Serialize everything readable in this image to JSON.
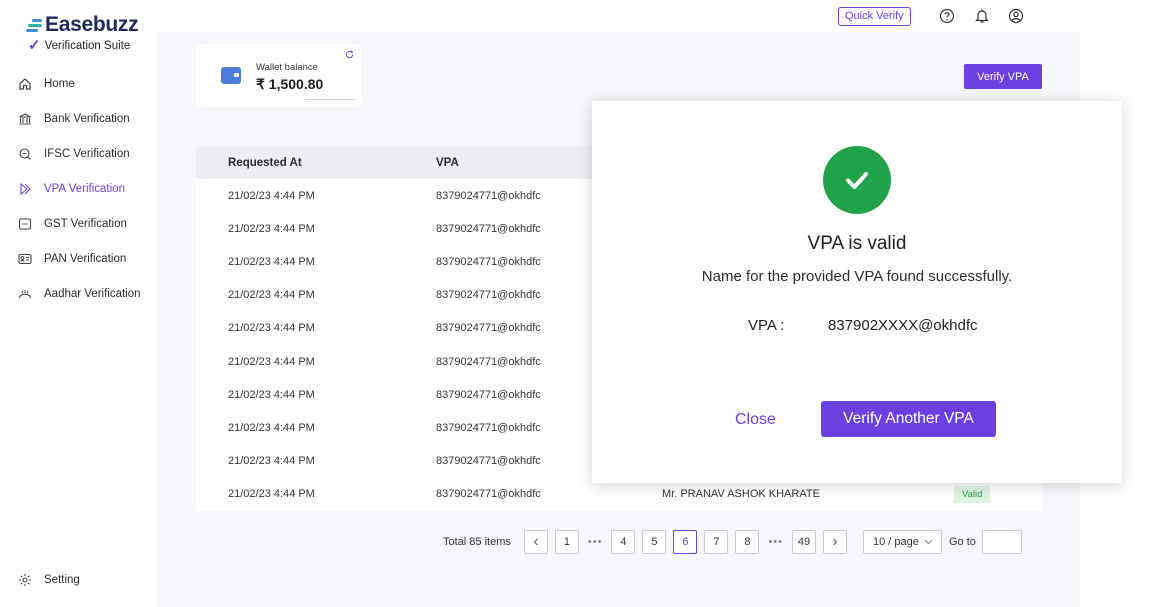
{
  "brand": {
    "name": "Easebuzz",
    "suite": "Verification Suite"
  },
  "sidebar": {
    "items": [
      {
        "label": "Home",
        "icon": "home-icon"
      },
      {
        "label": "Bank Verification",
        "icon": "bank-icon"
      },
      {
        "label": "IFSC Verification",
        "icon": "search-doc-icon"
      },
      {
        "label": "VPA Verification",
        "icon": "vpa-icon",
        "active": true
      },
      {
        "label": "GST Verification",
        "icon": "gst-icon"
      },
      {
        "label": "PAN Verification",
        "icon": "id-card-icon"
      },
      {
        "label": "Aadhar Verification",
        "icon": "aadhar-icon"
      }
    ],
    "setting_label": "Setting"
  },
  "topbar": {
    "quick_verify": "Quick Verify"
  },
  "wallet": {
    "label": "Wallet balance",
    "amount": "₹ 1,500.80"
  },
  "verify_vpa_button": "Verify VPA",
  "table": {
    "columns": [
      "Requested At",
      "VPA"
    ],
    "rows": [
      {
        "requested_at": "21/02/23 4:44 PM",
        "vpa": "8379024771@okhdfc"
      },
      {
        "requested_at": "21/02/23 4:44 PM",
        "vpa": "8379024771@okhdfc"
      },
      {
        "requested_at": "21/02/23 4:44 PM",
        "vpa": "8379024771@okhdfc"
      },
      {
        "requested_at": "21/02/23 4:44 PM",
        "vpa": "8379024771@okhdfc"
      },
      {
        "requested_at": "21/02/23 4:44 PM",
        "vpa": "8379024771@okhdfc"
      },
      {
        "requested_at": "21/02/23 4:44 PM",
        "vpa": "8379024771@okhdfc"
      },
      {
        "requested_at": "21/02/23 4:44 PM",
        "vpa": "8379024771@okhdfc"
      },
      {
        "requested_at": "21/02/23 4:44 PM",
        "vpa": "8379024771@okhdfc"
      },
      {
        "requested_at": "21/02/23 4:44 PM",
        "vpa": "8379024771@okhdfc"
      },
      {
        "requested_at": "21/02/23 4:44 PM",
        "vpa": "8379024771@okhdfc",
        "name": "Mr. PRANAV ASHOK KHARATE",
        "status": "Valid"
      }
    ]
  },
  "pagination": {
    "total": "Total 85 items",
    "prev": "<",
    "next": ">",
    "pages": [
      "1",
      "4",
      "5",
      "6",
      "7",
      "8",
      "49"
    ],
    "current": "6",
    "ellipsis": "•••",
    "per_page": "10 / page",
    "goto_label": "Go to"
  },
  "modal": {
    "title": "VPA is valid",
    "subtitle": "Name for the provided VPA found successfully.",
    "vpa_label": "VPA :",
    "vpa_value": "837902XXXX@okhdfc",
    "close_label": "Close",
    "another_label": "Verify Another VPA"
  },
  "colors": {
    "accent": "#6b3fe0",
    "success": "#21a34c",
    "background": "#f6f7fb"
  }
}
